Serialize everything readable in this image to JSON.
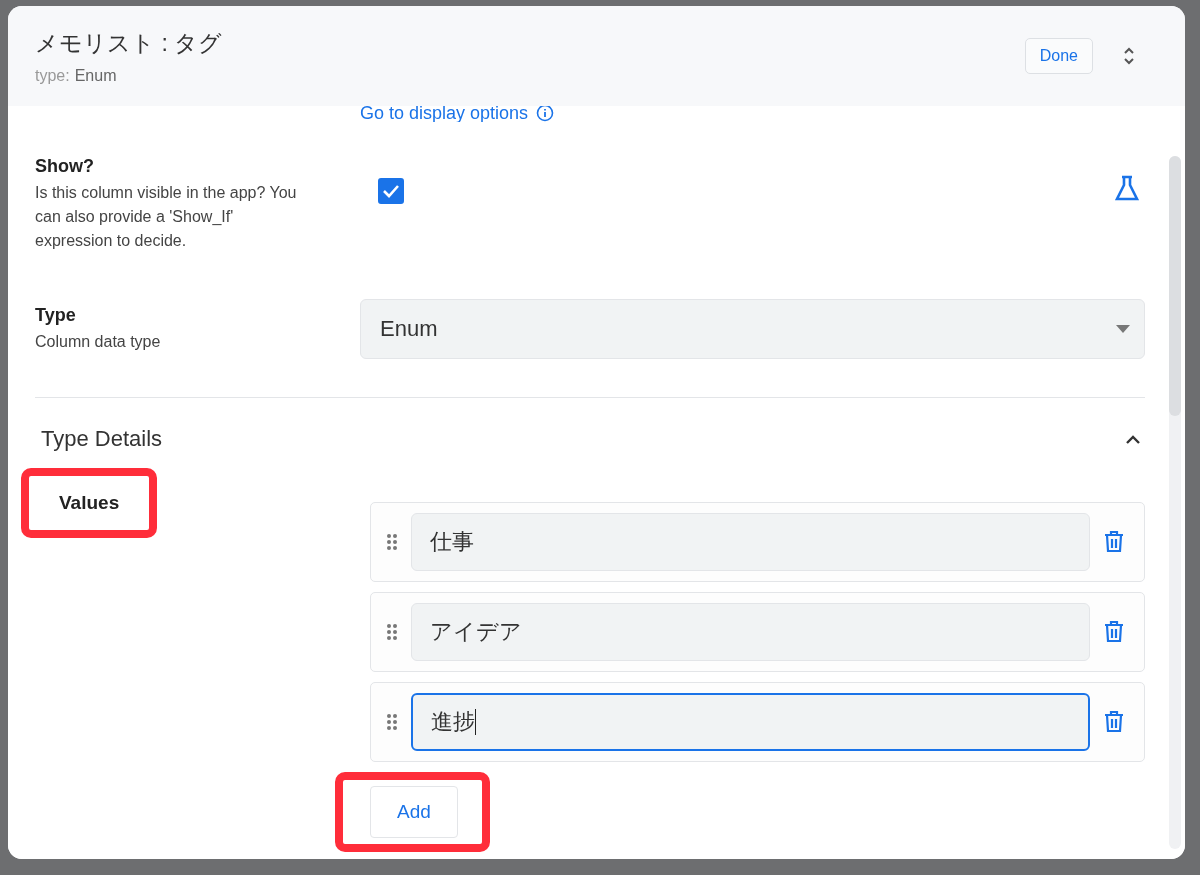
{
  "dialog": {
    "title": "メモリスト : タグ",
    "type_label": "type:",
    "type_value": "Enum",
    "done_button": "Done"
  },
  "display_link": "Go to display options",
  "fields": [
    {
      "kind": "checkbox",
      "label": "Show?",
      "description": "Is this column visible in the app? You can also provide a 'Show_If' expression to decide.",
      "checked": true
    },
    {
      "kind": "select",
      "label": "Type",
      "description": "Column data type",
      "value": "Enum"
    }
  ],
  "section": {
    "title": "Type Details",
    "expanded": true,
    "values_label": "Values",
    "highlighted": true,
    "values": [
      {
        "text": "仕事",
        "focused": false
      },
      {
        "text": "アイデア",
        "focused": false
      },
      {
        "text": "進捗",
        "focused": true
      }
    ],
    "add_button": "Add",
    "add_highlighted": true
  }
}
